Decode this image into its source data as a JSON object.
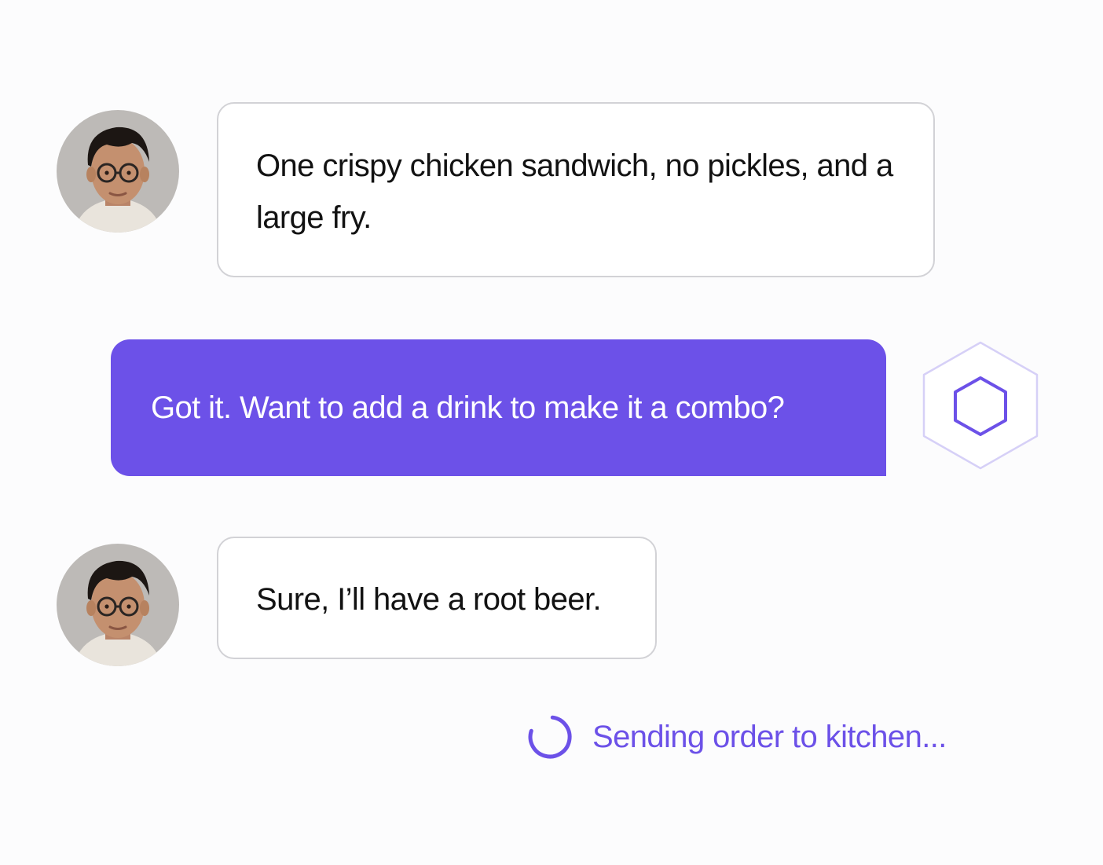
{
  "conversation": {
    "messages": [
      {
        "sender": "customer",
        "text": "One crispy chicken sandwich, no pickles, and a large fry."
      },
      {
        "sender": "assistant",
        "text": "Got it. Want to add a drink to make it a combo?"
      },
      {
        "sender": "customer",
        "text": "Sure, I’ll have a root beer."
      }
    ]
  },
  "status": {
    "text": "Sending order to kitchen...",
    "icon": "loading-spinner-icon"
  },
  "assistant_badge": {
    "icon": "hexagon-icon"
  },
  "colors": {
    "accent": "#6c51e8",
    "bubble_border": "#d2d2d6",
    "background": "#fcfcfd"
  }
}
